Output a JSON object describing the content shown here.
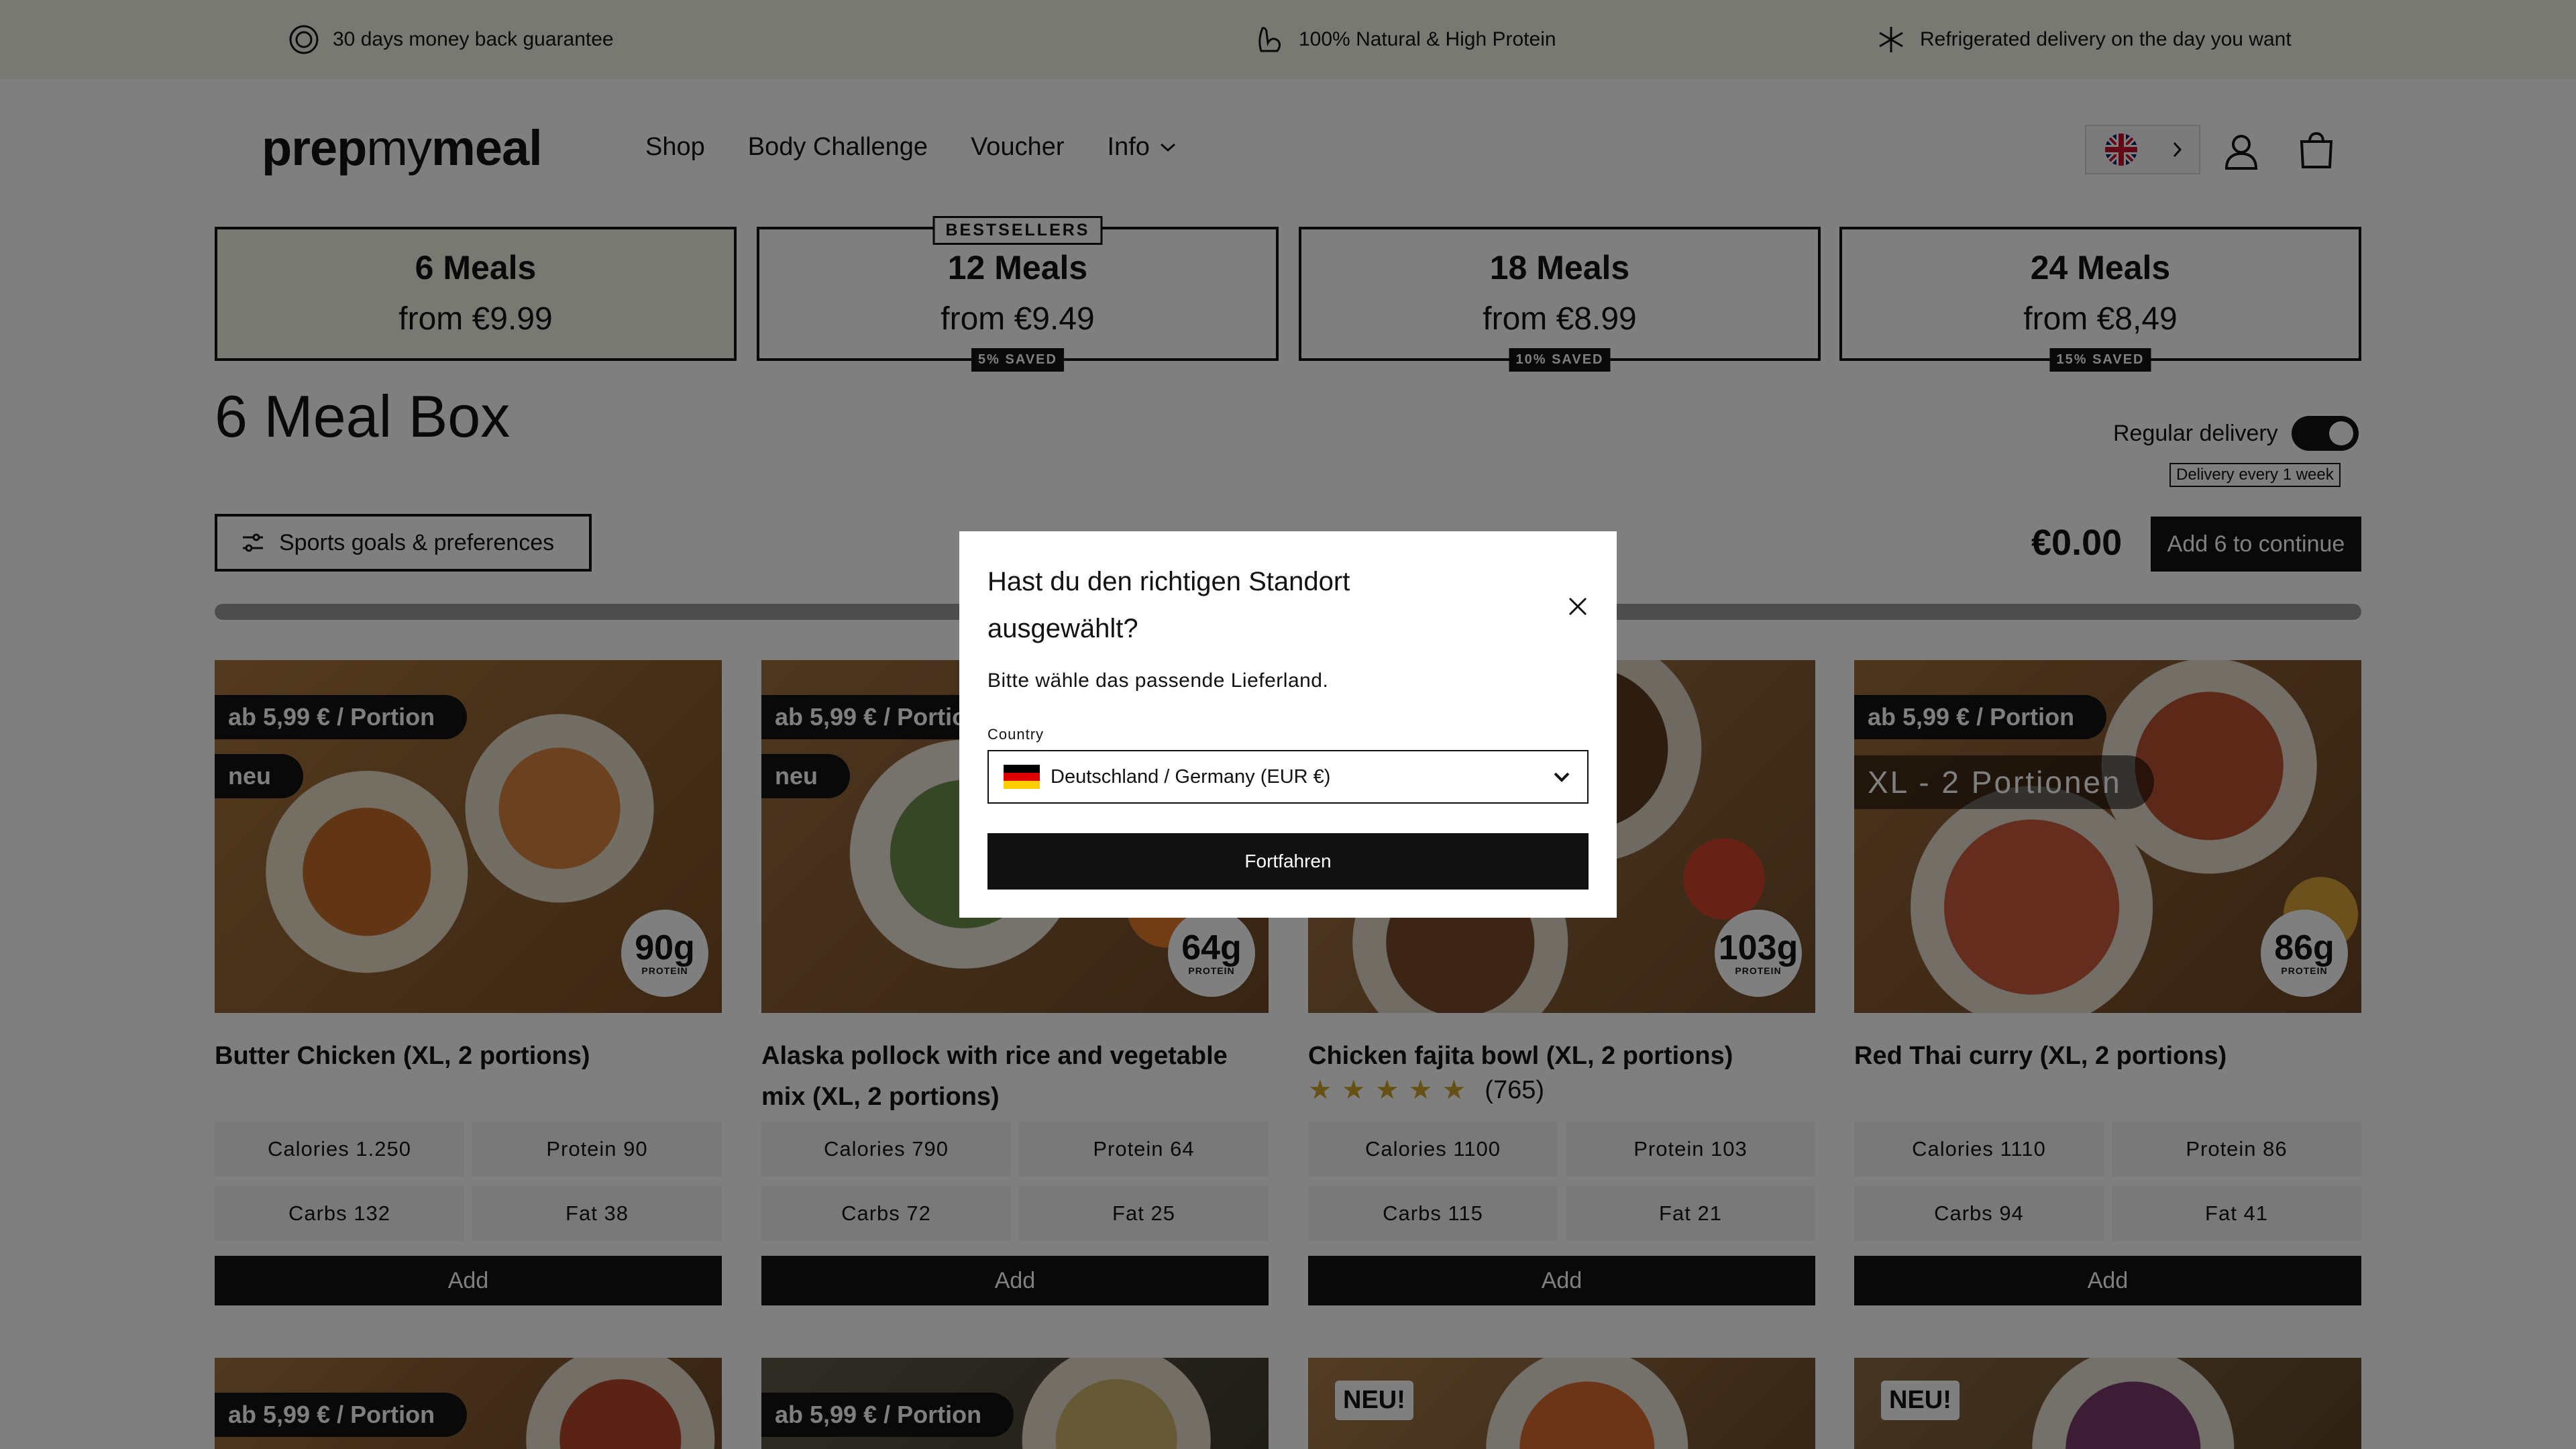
{
  "topbar": {
    "usp1": "30 days money back guarantee",
    "usp2": "100% Natural & High Protein",
    "usp3": "Refrigerated delivery on the day you want"
  },
  "header": {
    "logo_bold": "prep",
    "logo_light": "my",
    "logo_bold2": "meal",
    "nav": [
      "Shop",
      "Body Challenge",
      "Voucher",
      "Info"
    ]
  },
  "plans": [
    {
      "name": "6 Meals",
      "price": "from €9.99",
      "badge": "",
      "saved": ""
    },
    {
      "name": "12 Meals",
      "price": "from €9.49",
      "badge": "BESTSELLERS",
      "saved": "5% SAVED"
    },
    {
      "name": "18 Meals",
      "price": "from €8.99",
      "badge": "",
      "saved": "10% SAVED"
    },
    {
      "name": "24 Meals",
      "price": "from €8,49",
      "badge": "",
      "saved": "15% SAVED"
    }
  ],
  "box": {
    "title": "6 Meal Box",
    "regular_label": "Regular delivery",
    "delivery_every": "Delivery every 1 week",
    "prefs_label": "Sports goals & preferences",
    "total": "€0.00",
    "cta": "Add 6 to continue",
    "progress": 0
  },
  "meals": [
    {
      "pill": "ab 5,99 € / Portion",
      "tag": "neu",
      "protein": "90g",
      "title": "Butter Chicken (XL, 2 portions)",
      "rating": "",
      "stars": "",
      "calories": "Calories 1.250",
      "protein_m": "Protein 90",
      "carbs": "Carbs 132",
      "fat": "Fat 38"
    },
    {
      "pill": "ab 5,99 € / Portion",
      "tag": "neu",
      "protein": "64g",
      "title": "Alaska pollock with rice and vegetable mix (XL, 2 portions)",
      "rating": "",
      "stars": "",
      "calories": "Calories 790",
      "protein_m": "Protein 64",
      "carbs": "Carbs 72",
      "fat": "Fat 25"
    },
    {
      "pill": "",
      "tag": "",
      "protein": "103g",
      "title": "Chicken fajita bowl (XL, 2 portions)",
      "rating": "(765)",
      "stars": "★★★★★",
      "calories": "Calories 1100",
      "protein_m": "Protein 103",
      "carbs": "Carbs 115",
      "fat": "Fat 21"
    },
    {
      "pill": "ab 5,99 € / Portion",
      "tag": "XL - 2 Portionen",
      "protein": "86g",
      "title": "Red Thai curry (XL, 2 portions)",
      "rating": "",
      "stars": "",
      "calories": "Calories 1110",
      "protein_m": "Protein 86",
      "carbs": "Carbs 94",
      "fat": "Fat 41"
    }
  ],
  "protein_label": "PROTEIN",
  "add_label": "Add",
  "row2": [
    {
      "pill": "ab 5,99 € / Portion",
      "neu": ""
    },
    {
      "pill": "ab 5,99 € / Portion",
      "neu": ""
    },
    {
      "pill": "",
      "neu": "NEU!"
    },
    {
      "pill": "",
      "neu": "NEU!"
    }
  ],
  "modal": {
    "title": "Hast du den richtigen Standort ausgewählt?",
    "subtitle": "Bitte wähle das passende Lieferland.",
    "country_label": "Country",
    "country_value": "Deutschland / Germany (EUR €)",
    "button": "Fortfahren"
  },
  "colors": {
    "accent": "#121212",
    "cream": "#f3f2e6",
    "star": "#c9a227"
  }
}
